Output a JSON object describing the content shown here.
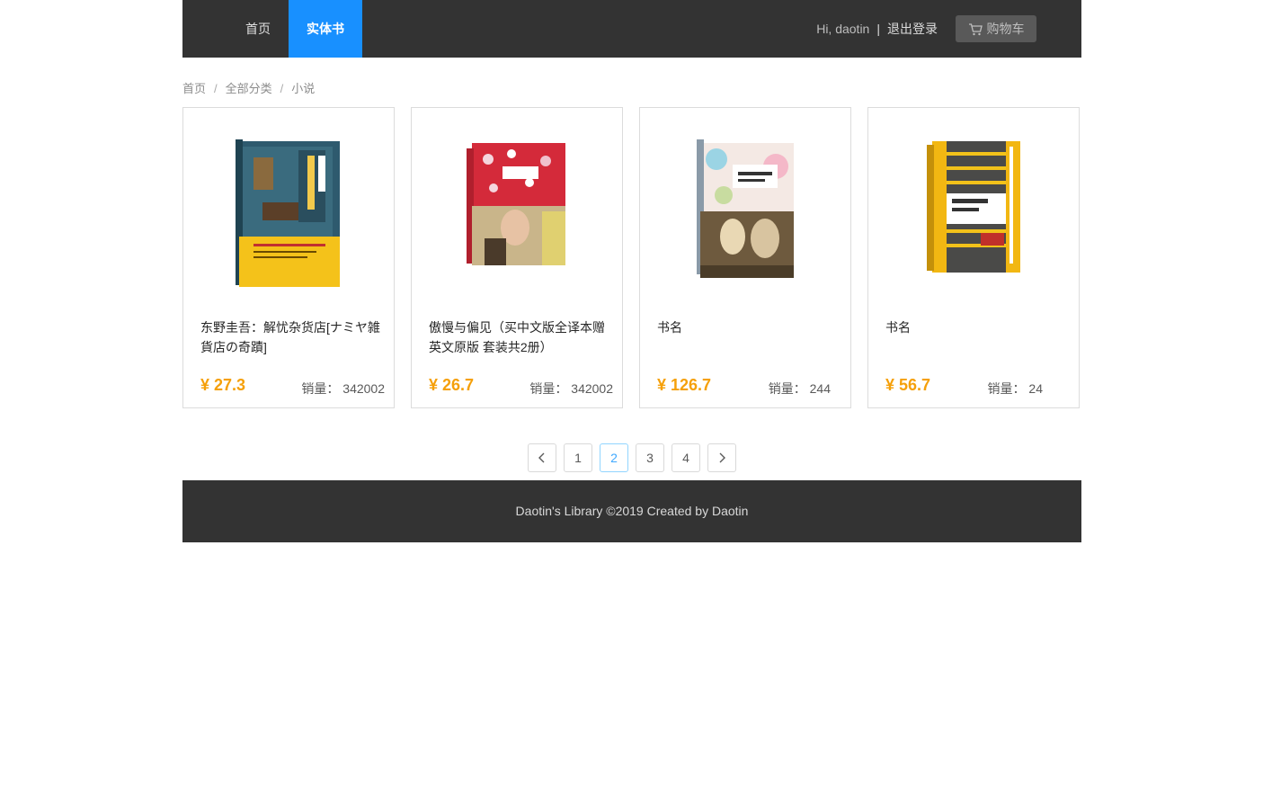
{
  "nav": {
    "home": "首页",
    "books": "实体书",
    "greeting": "Hi, daotin",
    "separator": "|",
    "logout": "退出登录",
    "cart": "购物车"
  },
  "breadcrumb": {
    "items": [
      "首页",
      "全部分类",
      "小说"
    ],
    "separator": "/"
  },
  "books": [
    {
      "title": "东野圭吾：解忧杂货店[ナミヤ雑貨店の奇蹟]",
      "price": "¥ 27.3",
      "sales_label": "销量：",
      "sales": "342002"
    },
    {
      "title": "傲慢与偏见（买中文版全译本赠英文原版 套装共2册）",
      "price": "¥ 26.7",
      "sales_label": "销量：",
      "sales": "342002"
    },
    {
      "title": "书名",
      "price": "¥ 126.7",
      "sales_label": "销量：",
      "sales": "244"
    },
    {
      "title": "书名",
      "price": "¥ 56.7",
      "sales_label": "销量：",
      "sales": "24"
    }
  ],
  "pagination": {
    "pages": [
      "1",
      "2",
      "3",
      "4"
    ],
    "current": "2",
    "prev": "‹",
    "next": "›"
  },
  "footer": {
    "text": "Daotin's Library ©2019 Created by Daotin"
  },
  "colors": {
    "header": "#333333",
    "accent": "#1890ff",
    "price": "#f5a00a"
  }
}
